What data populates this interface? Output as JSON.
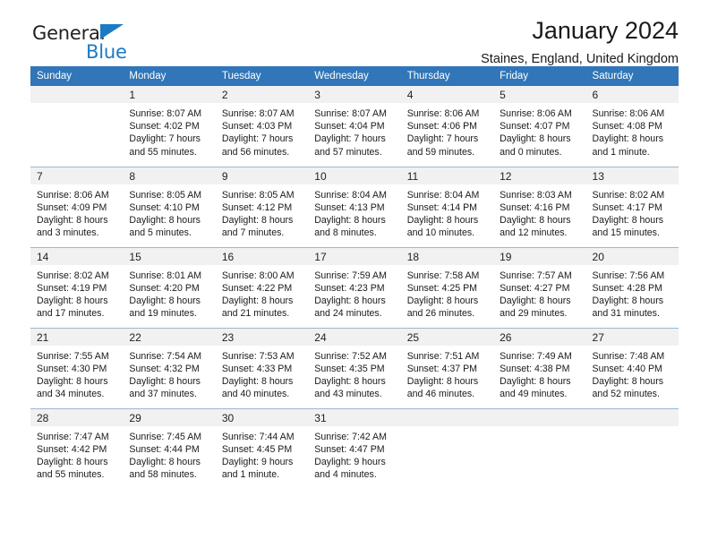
{
  "brand": {
    "name_top": "General",
    "name_bottom": "Blue",
    "triangle_color": "#1b7ac4",
    "text_color": "#231f20"
  },
  "header": {
    "title": "January 2024",
    "subtitle": "Staines, England, United Kingdom",
    "header_bg_color": "#3076b8",
    "daynum_bg_color": "#f1f1f1",
    "grid_line_color": "#9cb8d4"
  },
  "weekday_headers": [
    "Sunday",
    "Monday",
    "Tuesday",
    "Wednesday",
    "Thursday",
    "Friday",
    "Saturday"
  ],
  "weeks": [
    [
      {
        "day": "",
        "sunrise": "",
        "sunset": "",
        "daylight_line1": "",
        "daylight_line2": ""
      },
      {
        "day": "1",
        "sunrise": "Sunrise: 8:07 AM",
        "sunset": "Sunset: 4:02 PM",
        "daylight_line1": "Daylight: 7 hours",
        "daylight_line2": "and 55 minutes."
      },
      {
        "day": "2",
        "sunrise": "Sunrise: 8:07 AM",
        "sunset": "Sunset: 4:03 PM",
        "daylight_line1": "Daylight: 7 hours",
        "daylight_line2": "and 56 minutes."
      },
      {
        "day": "3",
        "sunrise": "Sunrise: 8:07 AM",
        "sunset": "Sunset: 4:04 PM",
        "daylight_line1": "Daylight: 7 hours",
        "daylight_line2": "and 57 minutes."
      },
      {
        "day": "4",
        "sunrise": "Sunrise: 8:06 AM",
        "sunset": "Sunset: 4:06 PM",
        "daylight_line1": "Daylight: 7 hours",
        "daylight_line2": "and 59 minutes."
      },
      {
        "day": "5",
        "sunrise": "Sunrise: 8:06 AM",
        "sunset": "Sunset: 4:07 PM",
        "daylight_line1": "Daylight: 8 hours",
        "daylight_line2": "and 0 minutes."
      },
      {
        "day": "6",
        "sunrise": "Sunrise: 8:06 AM",
        "sunset": "Sunset: 4:08 PM",
        "daylight_line1": "Daylight: 8 hours",
        "daylight_line2": "and 1 minute."
      }
    ],
    [
      {
        "day": "7",
        "sunrise": "Sunrise: 8:06 AM",
        "sunset": "Sunset: 4:09 PM",
        "daylight_line1": "Daylight: 8 hours",
        "daylight_line2": "and 3 minutes."
      },
      {
        "day": "8",
        "sunrise": "Sunrise: 8:05 AM",
        "sunset": "Sunset: 4:10 PM",
        "daylight_line1": "Daylight: 8 hours",
        "daylight_line2": "and 5 minutes."
      },
      {
        "day": "9",
        "sunrise": "Sunrise: 8:05 AM",
        "sunset": "Sunset: 4:12 PM",
        "daylight_line1": "Daylight: 8 hours",
        "daylight_line2": "and 7 minutes."
      },
      {
        "day": "10",
        "sunrise": "Sunrise: 8:04 AM",
        "sunset": "Sunset: 4:13 PM",
        "daylight_line1": "Daylight: 8 hours",
        "daylight_line2": "and 8 minutes."
      },
      {
        "day": "11",
        "sunrise": "Sunrise: 8:04 AM",
        "sunset": "Sunset: 4:14 PM",
        "daylight_line1": "Daylight: 8 hours",
        "daylight_line2": "and 10 minutes."
      },
      {
        "day": "12",
        "sunrise": "Sunrise: 8:03 AM",
        "sunset": "Sunset: 4:16 PM",
        "daylight_line1": "Daylight: 8 hours",
        "daylight_line2": "and 12 minutes."
      },
      {
        "day": "13",
        "sunrise": "Sunrise: 8:02 AM",
        "sunset": "Sunset: 4:17 PM",
        "daylight_line1": "Daylight: 8 hours",
        "daylight_line2": "and 15 minutes."
      }
    ],
    [
      {
        "day": "14",
        "sunrise": "Sunrise: 8:02 AM",
        "sunset": "Sunset: 4:19 PM",
        "daylight_line1": "Daylight: 8 hours",
        "daylight_line2": "and 17 minutes."
      },
      {
        "day": "15",
        "sunrise": "Sunrise: 8:01 AM",
        "sunset": "Sunset: 4:20 PM",
        "daylight_line1": "Daylight: 8 hours",
        "daylight_line2": "and 19 minutes."
      },
      {
        "day": "16",
        "sunrise": "Sunrise: 8:00 AM",
        "sunset": "Sunset: 4:22 PM",
        "daylight_line1": "Daylight: 8 hours",
        "daylight_line2": "and 21 minutes."
      },
      {
        "day": "17",
        "sunrise": "Sunrise: 7:59 AM",
        "sunset": "Sunset: 4:23 PM",
        "daylight_line1": "Daylight: 8 hours",
        "daylight_line2": "and 24 minutes."
      },
      {
        "day": "18",
        "sunrise": "Sunrise: 7:58 AM",
        "sunset": "Sunset: 4:25 PM",
        "daylight_line1": "Daylight: 8 hours",
        "daylight_line2": "and 26 minutes."
      },
      {
        "day": "19",
        "sunrise": "Sunrise: 7:57 AM",
        "sunset": "Sunset: 4:27 PM",
        "daylight_line1": "Daylight: 8 hours",
        "daylight_line2": "and 29 minutes."
      },
      {
        "day": "20",
        "sunrise": "Sunrise: 7:56 AM",
        "sunset": "Sunset: 4:28 PM",
        "daylight_line1": "Daylight: 8 hours",
        "daylight_line2": "and 31 minutes."
      }
    ],
    [
      {
        "day": "21",
        "sunrise": "Sunrise: 7:55 AM",
        "sunset": "Sunset: 4:30 PM",
        "daylight_line1": "Daylight: 8 hours",
        "daylight_line2": "and 34 minutes."
      },
      {
        "day": "22",
        "sunrise": "Sunrise: 7:54 AM",
        "sunset": "Sunset: 4:32 PM",
        "daylight_line1": "Daylight: 8 hours",
        "daylight_line2": "and 37 minutes."
      },
      {
        "day": "23",
        "sunrise": "Sunrise: 7:53 AM",
        "sunset": "Sunset: 4:33 PM",
        "daylight_line1": "Daylight: 8 hours",
        "daylight_line2": "and 40 minutes."
      },
      {
        "day": "24",
        "sunrise": "Sunrise: 7:52 AM",
        "sunset": "Sunset: 4:35 PM",
        "daylight_line1": "Daylight: 8 hours",
        "daylight_line2": "and 43 minutes."
      },
      {
        "day": "25",
        "sunrise": "Sunrise: 7:51 AM",
        "sunset": "Sunset: 4:37 PM",
        "daylight_line1": "Daylight: 8 hours",
        "daylight_line2": "and 46 minutes."
      },
      {
        "day": "26",
        "sunrise": "Sunrise: 7:49 AM",
        "sunset": "Sunset: 4:38 PM",
        "daylight_line1": "Daylight: 8 hours",
        "daylight_line2": "and 49 minutes."
      },
      {
        "day": "27",
        "sunrise": "Sunrise: 7:48 AM",
        "sunset": "Sunset: 4:40 PM",
        "daylight_line1": "Daylight: 8 hours",
        "daylight_line2": "and 52 minutes."
      }
    ],
    [
      {
        "day": "28",
        "sunrise": "Sunrise: 7:47 AM",
        "sunset": "Sunset: 4:42 PM",
        "daylight_line1": "Daylight: 8 hours",
        "daylight_line2": "and 55 minutes."
      },
      {
        "day": "29",
        "sunrise": "Sunrise: 7:45 AM",
        "sunset": "Sunset: 4:44 PM",
        "daylight_line1": "Daylight: 8 hours",
        "daylight_line2": "and 58 minutes."
      },
      {
        "day": "30",
        "sunrise": "Sunrise: 7:44 AM",
        "sunset": "Sunset: 4:45 PM",
        "daylight_line1": "Daylight: 9 hours",
        "daylight_line2": "and 1 minute."
      },
      {
        "day": "31",
        "sunrise": "Sunrise: 7:42 AM",
        "sunset": "Sunset: 4:47 PM",
        "daylight_line1": "Daylight: 9 hours",
        "daylight_line2": "and 4 minutes."
      },
      {
        "day": "",
        "sunrise": "",
        "sunset": "",
        "daylight_line1": "",
        "daylight_line2": ""
      },
      {
        "day": "",
        "sunrise": "",
        "sunset": "",
        "daylight_line1": "",
        "daylight_line2": ""
      },
      {
        "day": "",
        "sunrise": "",
        "sunset": "",
        "daylight_line1": "",
        "daylight_line2": ""
      }
    ]
  ]
}
